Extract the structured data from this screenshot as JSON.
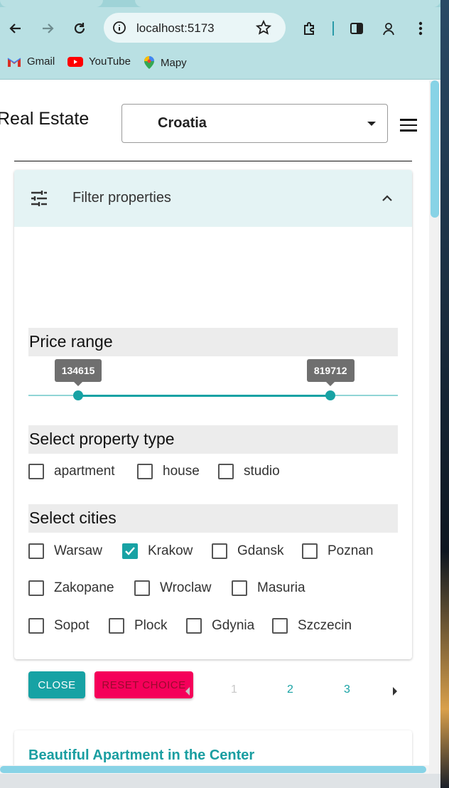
{
  "browser": {
    "url": "localhost:5173",
    "bookmarks": [
      "Gmail",
      "YouTube",
      "Mapy"
    ]
  },
  "header": {
    "brand": "Real Estate",
    "country_selected": "Croatia"
  },
  "filter": {
    "title": "Filter properties",
    "price": {
      "label": "Price range",
      "min_value": "134615",
      "max_value": "819712",
      "min_fraction": 0.135,
      "max_fraction": 0.818
    },
    "property_type": {
      "label": "Select property type",
      "options": [
        {
          "label": "apartment",
          "checked": false
        },
        {
          "label": "house",
          "checked": false
        },
        {
          "label": "studio",
          "checked": false
        }
      ]
    },
    "cities": {
      "label": "Select cities",
      "options": [
        {
          "label": "Warsaw",
          "checked": false
        },
        {
          "label": "Krakow",
          "checked": true
        },
        {
          "label": "Gdansk",
          "checked": false
        },
        {
          "label": "Poznan",
          "checked": false
        },
        {
          "label": "Zakopane",
          "checked": false
        },
        {
          "label": "Wroclaw",
          "checked": false
        },
        {
          "label": "Masuria",
          "checked": false
        },
        {
          "label": "Sopot",
          "checked": false
        },
        {
          "label": "Plock",
          "checked": false
        },
        {
          "label": "Gdynia",
          "checked": false
        },
        {
          "label": "Szczecin",
          "checked": false
        }
      ]
    },
    "close_label": "CLOSE",
    "reset_label": "RESET CHOICE"
  },
  "pagination": {
    "pages": [
      "1",
      "2",
      "3"
    ],
    "current": "1"
  },
  "listing": {
    "first_title": "Beautiful Apartment in the Center"
  },
  "colors": {
    "accent": "#17a2a4",
    "reset": "#f5005a",
    "chrome": "#b9e0e3"
  }
}
